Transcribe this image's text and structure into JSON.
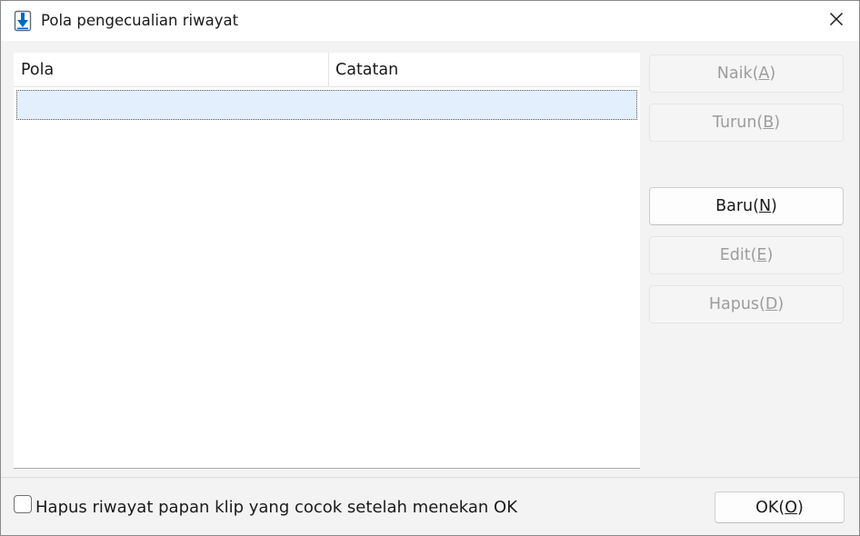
{
  "window": {
    "title": "Pola pengecualian riwayat",
    "icon": "download-arrow-icon",
    "close_icon": "close-icon"
  },
  "list": {
    "columns": [
      {
        "label": "Pola"
      },
      {
        "label": "Catatan"
      }
    ],
    "rows": [
      {
        "pola": "",
        "catatan": "",
        "selected": true
      }
    ]
  },
  "buttons": {
    "up": {
      "text": "Naik(",
      "key": "A",
      "end": ")",
      "enabled": false
    },
    "down": {
      "text": "Turun(",
      "key": "B",
      "end": ")",
      "enabled": false
    },
    "new": {
      "text": "Baru(",
      "key": "N",
      "end": ")",
      "enabled": true
    },
    "edit": {
      "text": "Edit(",
      "key": "E",
      "end": ")",
      "enabled": false
    },
    "delete": {
      "text": "Hapus(",
      "key": "D",
      "end": ")",
      "enabled": false
    },
    "ok": {
      "text": "OK(",
      "key": "O",
      "end": ")",
      "enabled": true
    }
  },
  "footer": {
    "checkbox_label": "Hapus riwayat papan klip yang cocok setelah menekan OK",
    "checkbox_checked": false
  },
  "colors": {
    "accent": "#0067c0",
    "selection": "#e3effc",
    "disabled_text": "#9d9d9d"
  }
}
